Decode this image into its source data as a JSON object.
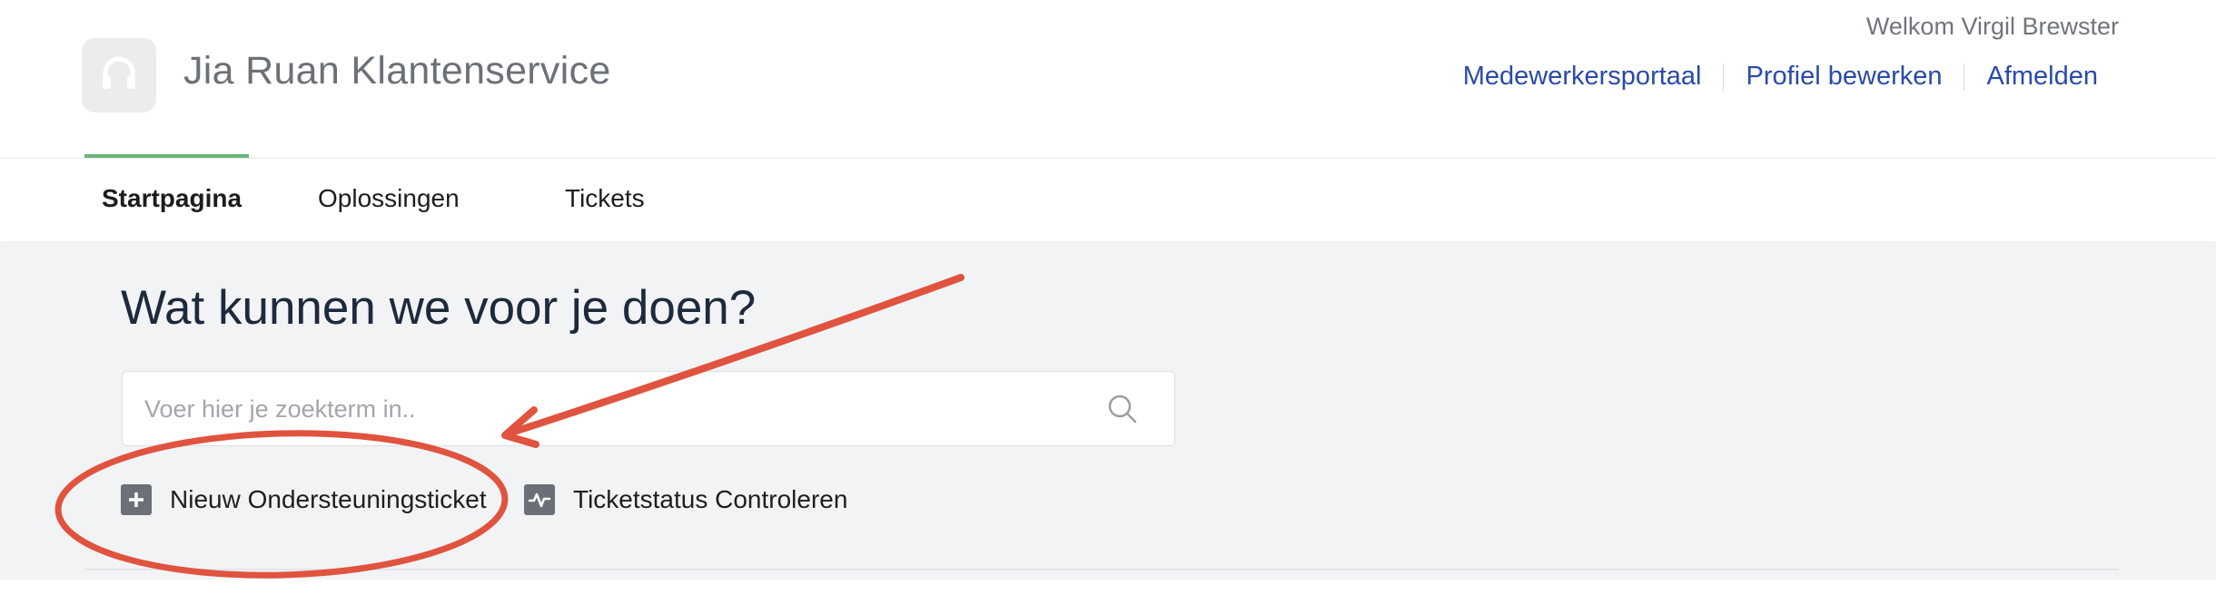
{
  "header": {
    "brand": "Jia Ruan Klantenservice",
    "welcome": "Welkom Virgil Brewster",
    "links": [
      "Medewerkersportaal",
      "Profiel bewerken",
      "Afmelden"
    ],
    "logo_icon": "headset-icon"
  },
  "nav": {
    "tabs": [
      "Startpagina",
      "Oplossingen",
      "Tickets"
    ],
    "active_tab": "Startpagina",
    "accent_color": "#6cb37a"
  },
  "main": {
    "headline": "Wat kunnen we voor je doen?",
    "search": {
      "placeholder": "Voer hier je zoekterm in..",
      "value": ""
    },
    "actions": [
      {
        "label": "Nieuw Ondersteuningsticket",
        "icon": "plus-icon"
      },
      {
        "label": "Ticketstatus Controleren",
        "icon": "pulse-icon"
      }
    ]
  },
  "annotation": {
    "color": "#e0533f",
    "shapes": [
      "arrow",
      "ellipse"
    ]
  }
}
